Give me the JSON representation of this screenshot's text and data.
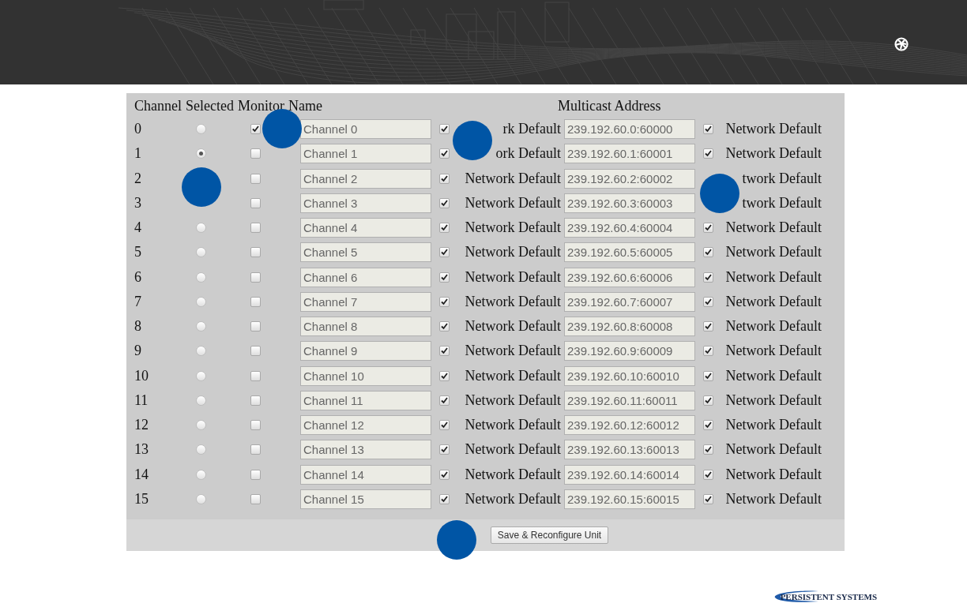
{
  "table": {
    "columns": [
      "Channel",
      "Selected",
      "Monitor",
      "Name",
      "Multicast Address"
    ],
    "rows": [
      {
        "channel": "0",
        "selected": false,
        "monitor": true,
        "name": "Channel 0",
        "name_default": {
          "checked": true,
          "label": "rk Default"
        },
        "address": "239.192.60.0:60000",
        "address_default": {
          "checked": true,
          "label": "Network Default"
        }
      },
      {
        "channel": "1",
        "selected": true,
        "monitor": false,
        "name": "Channel 1",
        "name_default": {
          "checked": true,
          "label": "ork Default"
        },
        "address": "239.192.60.1:60001",
        "address_default": {
          "checked": true,
          "label": "Network Default"
        }
      },
      {
        "channel": "2",
        "monitor": false,
        "name": "Channel 2",
        "name_default": {
          "checked": true,
          "label": "Network Default"
        },
        "address": "239.192.60.2:60002",
        "address_default": {
          "label": "twork Default"
        }
      },
      {
        "channel": "3",
        "monitor": false,
        "name": "Channel 3",
        "name_default": {
          "checked": true,
          "label": "Network Default"
        },
        "address": "239.192.60.3:60003",
        "address_default": {
          "label": "twork Default"
        }
      },
      {
        "channel": "4",
        "selected": false,
        "monitor": false,
        "name": "Channel 4",
        "name_default": {
          "checked": true,
          "label": "Network Default"
        },
        "address": "239.192.60.4:60004",
        "address_default": {
          "checked": true,
          "label": "Network Default"
        }
      },
      {
        "channel": "5",
        "selected": false,
        "monitor": false,
        "name": "Channel 5",
        "name_default": {
          "checked": true,
          "label": "Network Default"
        },
        "address": "239.192.60.5:60005",
        "address_default": {
          "checked": true,
          "label": "Network Default"
        }
      },
      {
        "channel": "6",
        "selected": false,
        "monitor": false,
        "name": "Channel 6",
        "name_default": {
          "checked": true,
          "label": "Network Default"
        },
        "address": "239.192.60.6:60006",
        "address_default": {
          "checked": true,
          "label": "Network Default"
        }
      },
      {
        "channel": "7",
        "selected": false,
        "monitor": false,
        "name": "Channel 7",
        "name_default": {
          "checked": true,
          "label": "Network Default"
        },
        "address": "239.192.60.7:60007",
        "address_default": {
          "checked": true,
          "label": "Network Default"
        }
      },
      {
        "channel": "8",
        "selected": false,
        "monitor": false,
        "name": "Channel 8",
        "name_default": {
          "checked": true,
          "label": "Network Default"
        },
        "address": "239.192.60.8:60008",
        "address_default": {
          "checked": true,
          "label": "Network Default"
        }
      },
      {
        "channel": "9",
        "selected": false,
        "monitor": false,
        "name": "Channel 9",
        "name_default": {
          "checked": true,
          "label": "Network Default"
        },
        "address": "239.192.60.9:60009",
        "address_default": {
          "checked": true,
          "label": "Network Default"
        }
      },
      {
        "channel": "10",
        "selected": false,
        "monitor": false,
        "name": "Channel 10",
        "name_default": {
          "checked": true,
          "label": "Network Default"
        },
        "address": "239.192.60.10:60010",
        "address_default": {
          "checked": true,
          "label": "Network Default"
        }
      },
      {
        "channel": "11",
        "selected": false,
        "monitor": false,
        "name": "Channel 11",
        "name_default": {
          "checked": true,
          "label": "Network Default"
        },
        "address": "239.192.60.11:60011",
        "address_default": {
          "checked": true,
          "label": "Network Default"
        }
      },
      {
        "channel": "12",
        "selected": false,
        "monitor": false,
        "name": "Channel 12",
        "name_default": {
          "checked": true,
          "label": "Network Default"
        },
        "address": "239.192.60.12:60012",
        "address_default": {
          "checked": true,
          "label": "Network Default"
        }
      },
      {
        "channel": "13",
        "selected": false,
        "monitor": false,
        "name": "Channel 13",
        "name_default": {
          "checked": true,
          "label": "Network Default"
        },
        "address": "239.192.60.13:60013",
        "address_default": {
          "checked": true,
          "label": "Network Default"
        }
      },
      {
        "channel": "14",
        "selected": false,
        "monitor": false,
        "name": "Channel 14",
        "name_default": {
          "checked": true,
          "label": "Network Default"
        },
        "address": "239.192.60.14:60014",
        "address_default": {
          "checked": true,
          "label": "Network Default"
        }
      },
      {
        "channel": "15",
        "selected": false,
        "monitor": false,
        "name": "Channel 15",
        "name_default": {
          "checked": true,
          "label": "Network Default"
        },
        "address": "239.192.60.15:60015",
        "address_default": {
          "checked": true,
          "label": "Network Default"
        }
      }
    ]
  },
  "save_button": "Save & Reconfigure Unit",
  "footer": {
    "logo_text": "PERSISTENT SYSTEMS"
  }
}
